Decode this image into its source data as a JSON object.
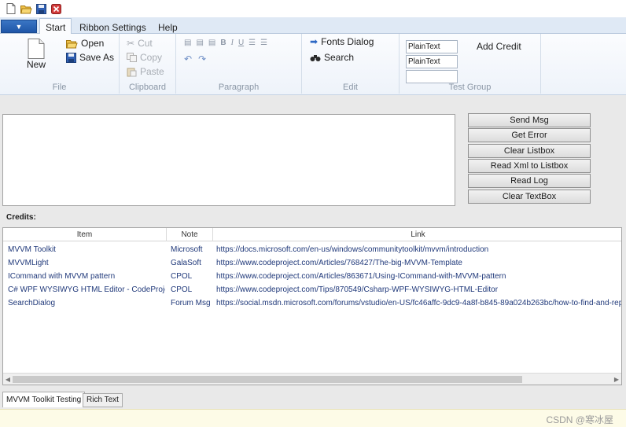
{
  "ribbon": {
    "tabs": [
      "Start",
      "Ribbon Settings",
      "Help"
    ],
    "file_group": {
      "label": "File",
      "new": "New",
      "open": "Open",
      "save_as": "Save As"
    },
    "clipboard_group": {
      "label": "Clipboard",
      "cut": "Cut",
      "copy": "Copy",
      "paste": "Paste"
    },
    "paragraph_group": {
      "label": "Paragraph"
    },
    "edit_group": {
      "label": "Edit",
      "fonts_dialog": "Fonts Dialog",
      "search": "Search"
    },
    "test_group": {
      "label": "Test Group",
      "textbox1": "PlainText",
      "textbox2": "PlainText",
      "textbox3": "",
      "add_credit": "Add Credit"
    }
  },
  "buttons": {
    "send_msg": "Send Msg",
    "get_error": "Get Error",
    "clear_listbox": "Clear Listbox",
    "read_xml": "Read Xml to Listbox",
    "read_log": "Read Log",
    "clear_textbox": "Clear TextBox"
  },
  "credits": {
    "label": "Credits:",
    "columns": [
      "Item",
      "Note",
      "Link"
    ],
    "rows": [
      {
        "item": "MVVM Toolkit",
        "note": "Microsoft",
        "link": "https://docs.microsoft.com/en-us/windows/communitytoolkit/mvvm/introduction"
      },
      {
        "item": "MVVMLight",
        "note": "GalaSoft",
        "link": "https://www.codeproject.com/Articles/768427/The-big-MVVM-Template"
      },
      {
        "item": "ICommand with MVVM pattern",
        "note": "CPOL",
        "link": "https://www.codeproject.com/Articles/863671/Using-ICommand-with-MVVM-pattern"
      },
      {
        "item": "C# WPF WYSIWYG HTML Editor - CodeProject",
        "note": "CPOL",
        "link": "https://www.codeproject.com/Tips/870549/Csharp-WPF-WYSIWYG-HTML-Editor"
      },
      {
        "item": "SearchDialog",
        "note": "Forum Msg",
        "link": "https://social.msdn.microsoft.com/forums/vstudio/en-US/fc46affc-9dc9-4a8f-b845-89a024b263bc/how-to-find-and-rep"
      }
    ]
  },
  "bottom_tabs": [
    "MVVM Toolkit Testing",
    "Rich Text"
  ],
  "watermark": "CSDN @寒冰屋",
  "colors": {
    "accent": "#2a62b5",
    "link_text": "#20397a",
    "status_bar": "#fdfbe7"
  }
}
